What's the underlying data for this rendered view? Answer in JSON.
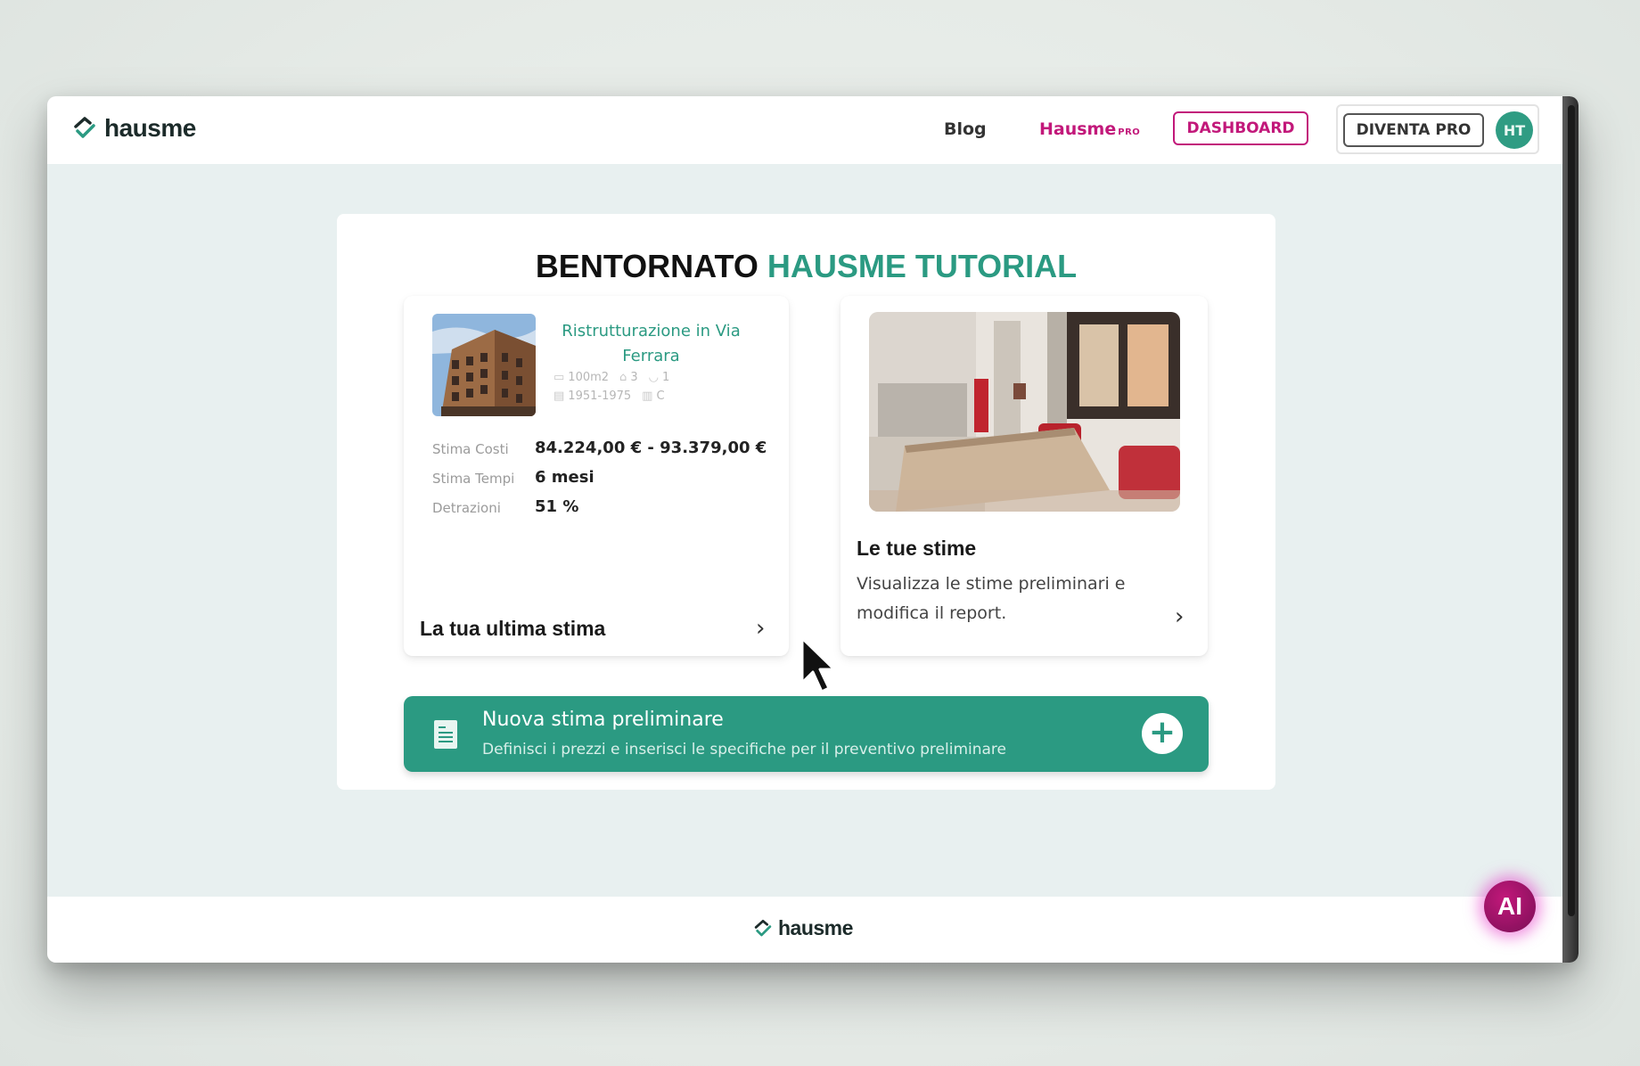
{
  "brand": {
    "name": "hausme"
  },
  "nav": {
    "blog": "Blog",
    "hausme_pro": "Hausme",
    "hausme_pro_sup": "PRO",
    "dashboard": "DASHBOARD",
    "become_pro": "DIVENTA PRO",
    "avatar_initials": "HT"
  },
  "welcome": {
    "prefix": "BENTORNATO",
    "name": "HAUSME TUTORIAL"
  },
  "last_estimate": {
    "project_title": "Ristrutturazione in Via Ferrara",
    "area": "100m2",
    "rooms": "3",
    "bathrooms": "1",
    "years": "1951-1975",
    "energy_class": "C",
    "stats": [
      {
        "label": "Stima Costi",
        "value": "84.224,00 € - 93.379,00 €"
      },
      {
        "label": "Stima Tempi",
        "value": "6 mesi"
      },
      {
        "label": "Detrazioni",
        "value": "51 %"
      }
    ],
    "link_label": "La tua ultima stima"
  },
  "your_estimates": {
    "heading": "Le tue stime",
    "description": "Visualizza le stime preliminari e modifica il report."
  },
  "new_estimate": {
    "title": "Nuova stima preliminare",
    "subtitle": "Definisci i prezzi e inserisci le specifiche per il preventivo preliminare"
  },
  "ai_button": "AI",
  "colors": {
    "accent": "#2b9a82",
    "brand_pink": "#c2187a"
  }
}
